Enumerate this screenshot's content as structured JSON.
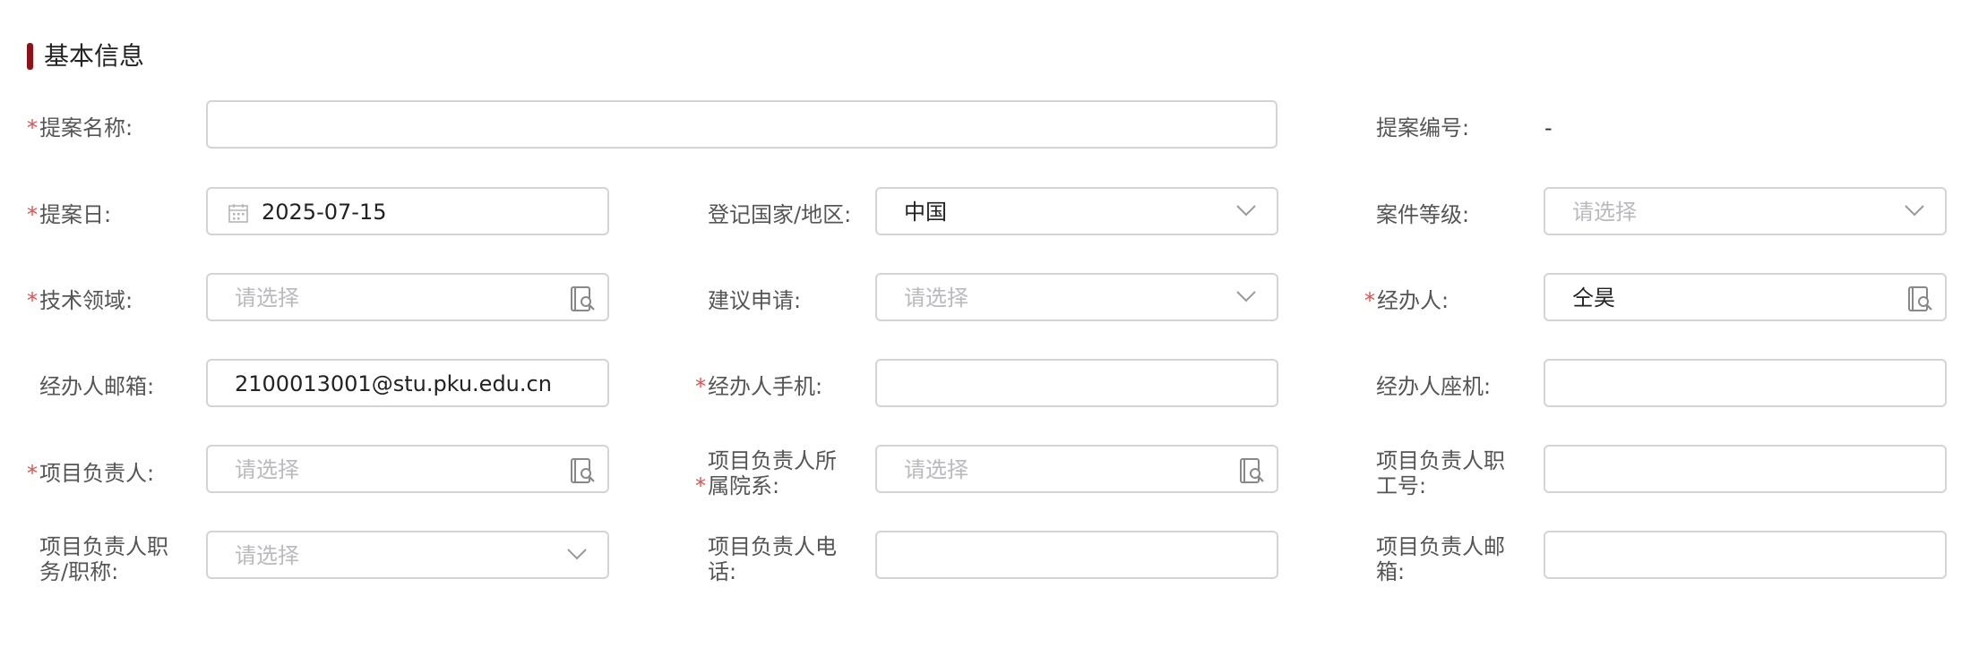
{
  "section": {
    "title": "基本信息"
  },
  "fields": {
    "proposal_name": {
      "label": "提案名称:",
      "value": ""
    },
    "proposal_no": {
      "label": "提案编号:",
      "value": "-"
    },
    "proposal_date": {
      "label": "提案日:",
      "value": "2025-07-15"
    },
    "country": {
      "label": "登记国家/地区:",
      "value": "中国"
    },
    "case_level": {
      "label": "案件等级:",
      "placeholder": "请选择"
    },
    "tech_field": {
      "label": "技术领域:",
      "placeholder": "请选择"
    },
    "suggest_apply": {
      "label": "建议申请:",
      "placeholder": "请选择"
    },
    "handler": {
      "label": "经办人:",
      "value": "仝昊"
    },
    "handler_email": {
      "label": "经办人邮箱:",
      "value": "2100013001@stu.pku.edu.cn"
    },
    "handler_mobile": {
      "label": "经办人手机:",
      "value": ""
    },
    "handler_phone": {
      "label": "经办人座机:",
      "value": ""
    },
    "project_leader": {
      "label": "项目负责人:",
      "placeholder": "请选择"
    },
    "leader_dept": {
      "label_line1": "项目负责人所",
      "label_line2": "属院系:",
      "placeholder": "请选择"
    },
    "leader_staff_no": {
      "label_line1": "项目负责人职",
      "label_line2": "工号:",
      "value": ""
    },
    "leader_title": {
      "label_line1": "项目负责人职",
      "label_line2": "务/职称:",
      "placeholder": "请选择"
    },
    "leader_tel": {
      "label_line1": "项目负责人电",
      "label_line2": "话:",
      "value": ""
    },
    "leader_email": {
      "label_line1": "项目负责人邮",
      "label_line2": "箱:",
      "value": ""
    }
  },
  "required_marker": "*",
  "icons": {
    "calendar": "calendar-icon",
    "dropdown": "chevron-down-icon",
    "picker": "address-book-search-icon"
  },
  "colors": {
    "accent": "#8d1116",
    "required": "#e05050",
    "placeholder": "#b9b9bf",
    "border": "#d4d4d4"
  }
}
